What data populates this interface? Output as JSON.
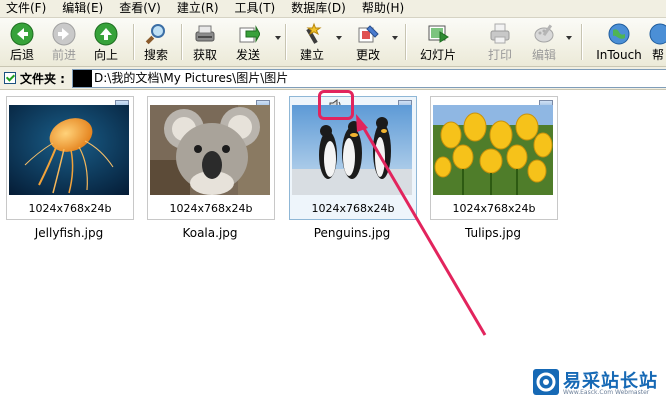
{
  "menu": [
    "文件(F)",
    "编辑(E)",
    "查看(V)",
    "建立(R)",
    "工具(T)",
    "数据库(D)",
    "帮助(H)"
  ],
  "toolbar": {
    "back": "后退",
    "forward": "前进",
    "up": "向上",
    "search": "搜索",
    "acquire": "获取",
    "send": "发送",
    "create": "建立",
    "modify": "更改",
    "slideshow": "幻灯片",
    "print": "打印",
    "edit": "编辑",
    "intouch": "InTouch",
    "help": "帮"
  },
  "address": {
    "label": "文件夹 :",
    "path": "D:\\我的文档\\My Pictures\\图片\\图片"
  },
  "thumbnails": [
    {
      "info": "1024x768x24b",
      "name": "Jellyfish.jpg"
    },
    {
      "info": "1024x768x24b",
      "name": "Koala.jpg"
    },
    {
      "info": "1024x768x24b",
      "name": "Penguins.jpg"
    },
    {
      "info": "1024x768x24b",
      "name": "Tulips.jpg"
    }
  ],
  "watermark": {
    "title": "易采站长站",
    "subtitle": "Www.Easck.Com Webmaster"
  },
  "colors": {
    "highlight": "#e2245d",
    "toolbar_bg": "#ecead8",
    "selected_border": "#8fb7d6"
  }
}
